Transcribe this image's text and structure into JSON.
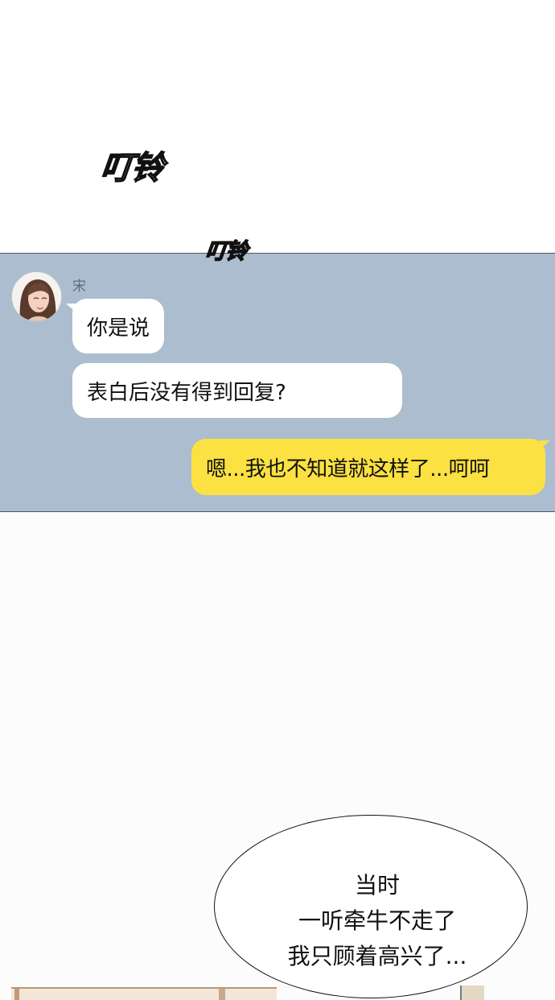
{
  "sound_effects": [
    "叮铃",
    "叮铃"
  ],
  "chat": {
    "contact_name": "宋",
    "messages": [
      {
        "side": "left",
        "text": "你是说"
      },
      {
        "side": "left",
        "text": "表白后没有得到回复?"
      },
      {
        "side": "right",
        "text": "嗯...我也不知道就这样了...呵呵"
      }
    ],
    "colors": {
      "background": "#acbdd0",
      "incoming_bubble": "#ffffff",
      "outgoing_bubble": "#fbe141"
    }
  },
  "narration": {
    "lines": [
      "当时",
      "一听牵牛不走了",
      "我只顾着高兴了..."
    ]
  }
}
